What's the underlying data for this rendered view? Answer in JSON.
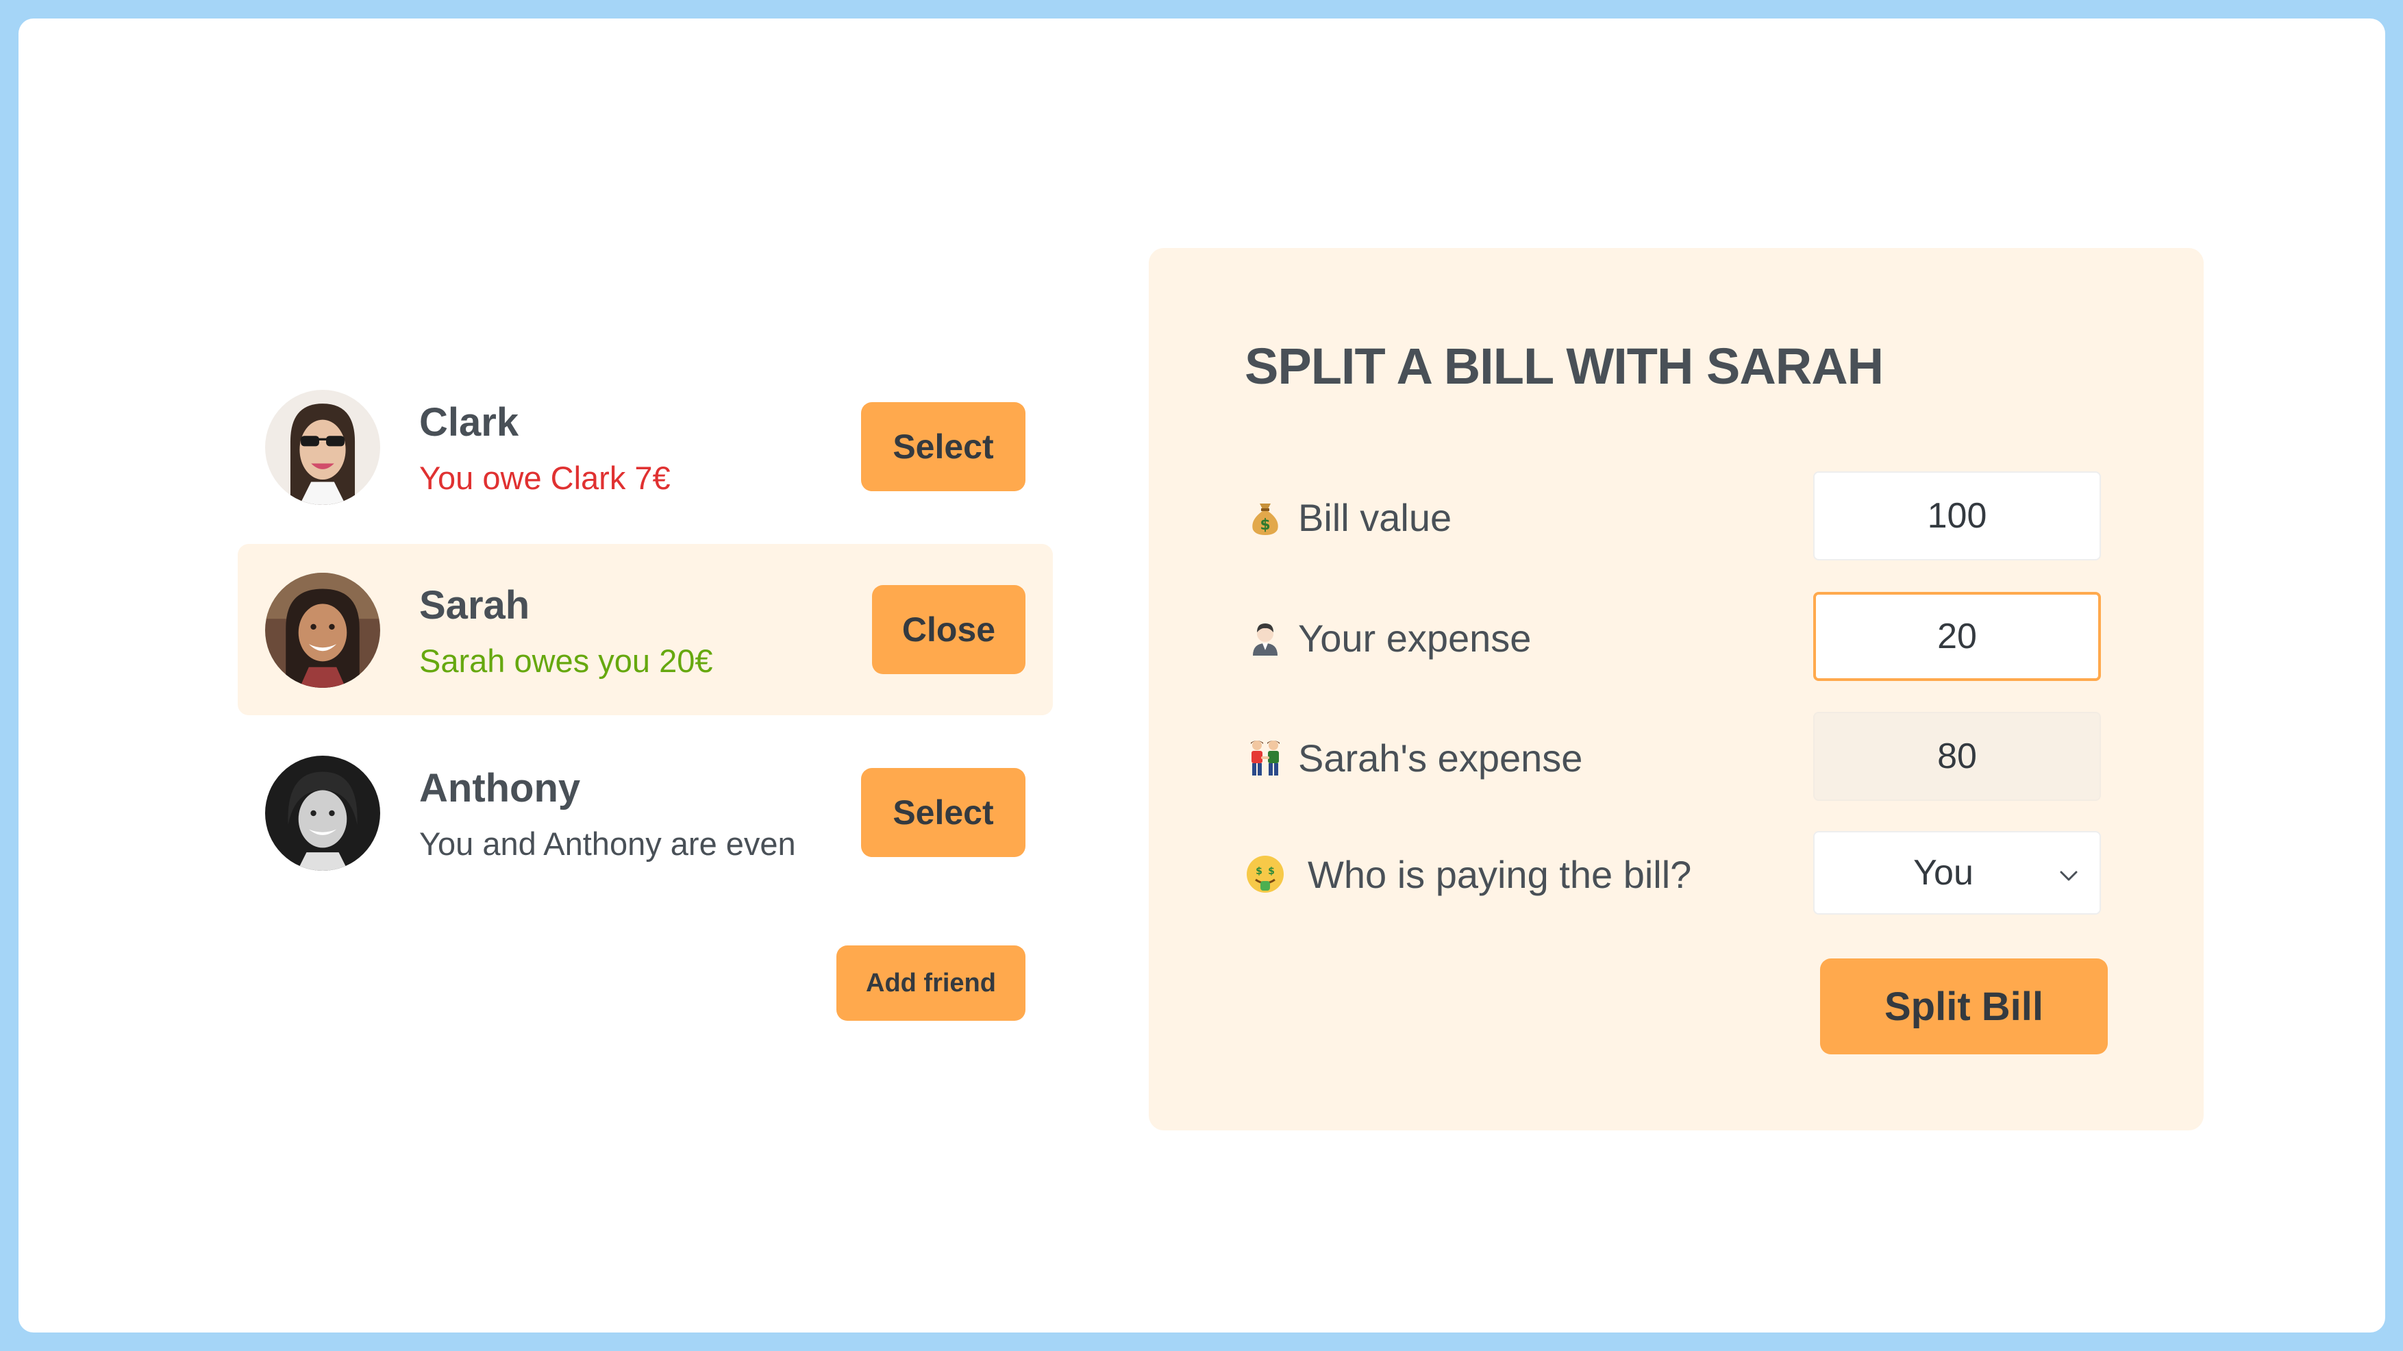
{
  "friends": [
    {
      "name": "Clark",
      "status": "You owe Clark 7€",
      "button": "Select",
      "avatar": "avatar-clark"
    },
    {
      "name": "Sarah",
      "status": "Sarah owes you 20€",
      "button": "Close",
      "avatar": "avatar-sarah"
    },
    {
      "name": "Anthony",
      "status": "You and Anthony are even",
      "button": "Select",
      "avatar": "avatar-anthony"
    }
  ],
  "add_friend_label": "Add friend",
  "form": {
    "title": "SPLIT A BILL WITH SARAH",
    "bill_label": "Bill value",
    "bill_icon": "money-bag-icon",
    "bill_value": "100",
    "your_label": "Your expense",
    "your_icon": "person-icon",
    "your_value": "20",
    "friend_label": "Sarah's expense",
    "friend_icon": "two-people-icon",
    "friend_value": "80",
    "payer_label": "Who is paying the bill?",
    "payer_icon": "money-mouth-face-icon",
    "payer_value": "You",
    "submit_label": "Split Bill"
  },
  "colors": {
    "accent": "#ffa94d",
    "panel": "#fff4e6",
    "owe": "#e03131",
    "owed": "#66a80f",
    "background": "#a5d5f7"
  }
}
